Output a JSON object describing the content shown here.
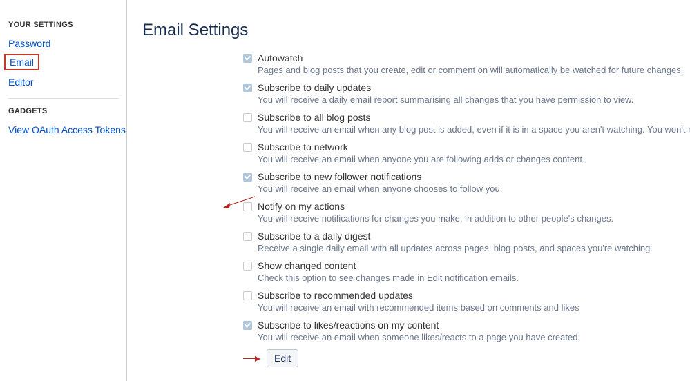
{
  "sidebar": {
    "heading1": "YOUR SETTINGS",
    "heading2": "GADGETS",
    "links": {
      "password": "Password",
      "email": "Email",
      "editor": "Editor",
      "oauth": "View OAuth Access Tokens"
    }
  },
  "page": {
    "title": "Email Settings",
    "edit_label": "Edit"
  },
  "settings": [
    {
      "label": "Autowatch",
      "desc": "Pages and blog posts that you create, edit or comment on will automatically be watched for future changes.",
      "checked": true
    },
    {
      "label": "Subscribe to daily updates",
      "desc": "You will receive a daily email report summarising all changes that you have permission to view.",
      "checked": true
    },
    {
      "label": "Subscribe to all blog posts",
      "desc": "You will receive an email when any blog post is added, even if it is in a space you aren't watching. You won't receive emails for comments on tho",
      "checked": false
    },
    {
      "label": "Subscribe to network",
      "desc": "You will receive an email when anyone you are following adds or changes content.",
      "checked": false
    },
    {
      "label": "Subscribe to new follower notifications",
      "desc": "You will receive an email when anyone chooses to follow you.",
      "checked": true
    },
    {
      "label": "Notify on my actions",
      "desc": "You will receive notifications for changes you make, in addition to other people's changes.",
      "checked": false
    },
    {
      "label": "Subscribe to a daily digest",
      "desc": "Receive a single daily email with all updates across pages, blog posts, and spaces you're watching.",
      "checked": false
    },
    {
      "label": "Show changed content",
      "desc": "Check this option to see changes made in Edit notification emails.",
      "checked": false
    },
    {
      "label": "Subscribe to recommended updates",
      "desc": "You will receive an email with recommended items based on comments and likes",
      "checked": false
    },
    {
      "label": "Subscribe to likes/reactions on my content",
      "desc": "You will receive an email when someone likes/reacts to a page you have created.",
      "checked": true
    }
  ]
}
